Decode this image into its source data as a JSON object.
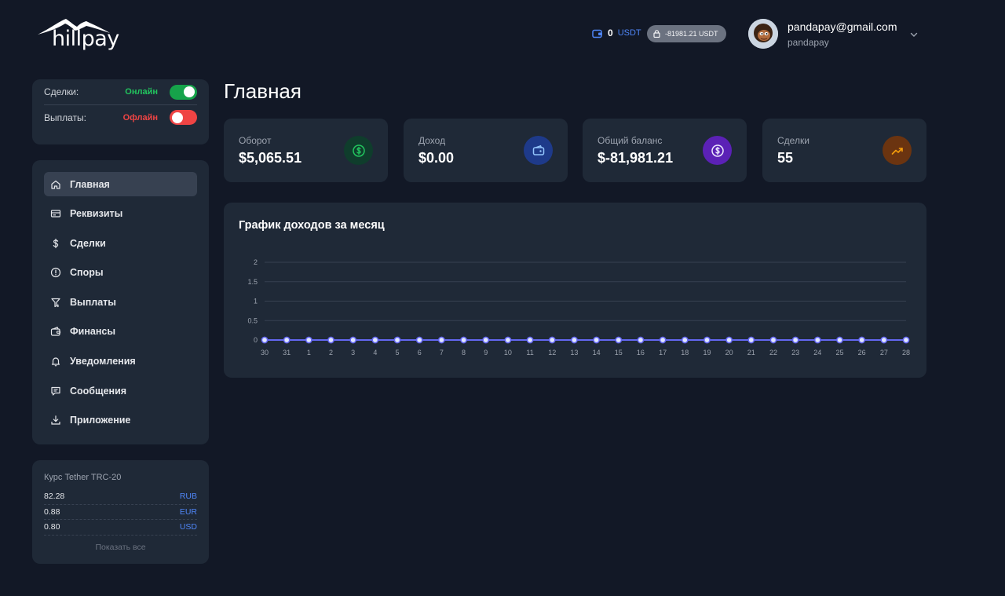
{
  "header": {
    "logo_text": "hillpay",
    "wallet_balance": "0",
    "wallet_currency": "USDT",
    "locked_balance": "-81981.21 USDT",
    "user_email": "pandapay@gmail.com",
    "user_name": "pandapay"
  },
  "status": {
    "deals_label": "Сделки:",
    "deals_value": "Онлайн",
    "payouts_label": "Выплаты:",
    "payouts_value": "Офлайн"
  },
  "nav": {
    "items": [
      {
        "label": "Главная",
        "icon": "home-icon"
      },
      {
        "label": "Реквизиты",
        "icon": "card-icon"
      },
      {
        "label": "Сделки",
        "icon": "dollar-icon"
      },
      {
        "label": "Споры",
        "icon": "alert-circle-icon"
      },
      {
        "label": "Выплаты",
        "icon": "payout-icon"
      },
      {
        "label": "Финансы",
        "icon": "wallet-icon"
      },
      {
        "label": "Уведомления",
        "icon": "bell-icon"
      },
      {
        "label": "Сообщения",
        "icon": "message-icon"
      },
      {
        "label": "Приложение",
        "icon": "download-icon"
      }
    ]
  },
  "rates": {
    "title": "Курс Tether TRC-20",
    "rows": [
      {
        "value": "82.28",
        "currency": "RUB"
      },
      {
        "value": "0.88",
        "currency": "EUR"
      },
      {
        "value": "0.80",
        "currency": "USD"
      }
    ],
    "show_all": "Показать все"
  },
  "main": {
    "title": "Главная",
    "stats": [
      {
        "label": "Оборот",
        "value": "$5,065.51",
        "icon": "dollar-circle-icon",
        "color": "#22c55e",
        "bg": "#0f3d2c"
      },
      {
        "label": "Доход",
        "value": "$0.00",
        "icon": "wallet-icon",
        "color": "#60a5fa",
        "bg": "#1e3a8a"
      },
      {
        "label": "Общий баланс",
        "value": "$-81,981.21",
        "icon": "dollar-circle-icon",
        "color": "#ddd6fe",
        "bg": "#5b21b6"
      },
      {
        "label": "Сделки",
        "value": "55",
        "icon": "trending-up-icon",
        "color": "#f59e0b",
        "bg": "#6b3410"
      }
    ],
    "chart_title": "График доходов за месяц"
  },
  "chart_data": {
    "type": "line",
    "title": "График доходов за месяц",
    "x": [
      "30",
      "31",
      "1",
      "2",
      "3",
      "4",
      "5",
      "6",
      "7",
      "8",
      "9",
      "10",
      "11",
      "12",
      "13",
      "14",
      "15",
      "16",
      "17",
      "18",
      "19",
      "20",
      "21",
      "22",
      "23",
      "24",
      "25",
      "26",
      "27",
      "28"
    ],
    "series": [
      {
        "values": [
          0,
          0,
          0,
          0,
          0,
          0,
          0,
          0,
          0,
          0,
          0,
          0,
          0,
          0,
          0,
          0,
          0,
          0,
          0,
          0,
          0,
          0,
          0,
          0,
          0,
          0,
          0,
          0,
          0,
          0
        ]
      }
    ],
    "yticks": [
      "0",
      "0.5",
      "1",
      "1.5",
      "2"
    ],
    "ylim": [
      0,
      2
    ],
    "grid": true,
    "line_color": "#6366f1"
  }
}
